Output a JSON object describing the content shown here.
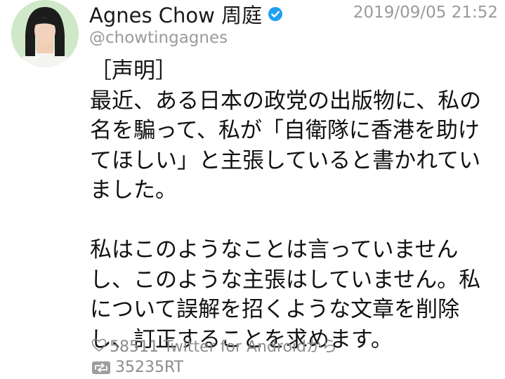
{
  "tweet": {
    "display_name": "Agnes Chow 周庭",
    "handle": "@chowtingagnes",
    "timestamp": "2019/09/05 21:52",
    "text": "［声明］\n最近、ある日本の政党の出版物に、私の名を騙って、私が「自衛隊に香港を助けてほしい」と主張していると書かれていました。\n\n私はこのようなことは言っていませんし、このような主張はしていません。私について誤解を招くような文章を削除し、訂正することを求めます。",
    "likes_and_source": "58511 Twitter for Androidから",
    "retweets": "35235RT",
    "verified": true
  },
  "icons": {
    "verified": "verified-badge-icon",
    "like": "heart-icon",
    "retweet": "retweet-icon"
  },
  "colors": {
    "verified_blue": "#1da1f2",
    "muted_text": "#9a9a9a",
    "avatar_background": "#cfe8c9"
  }
}
